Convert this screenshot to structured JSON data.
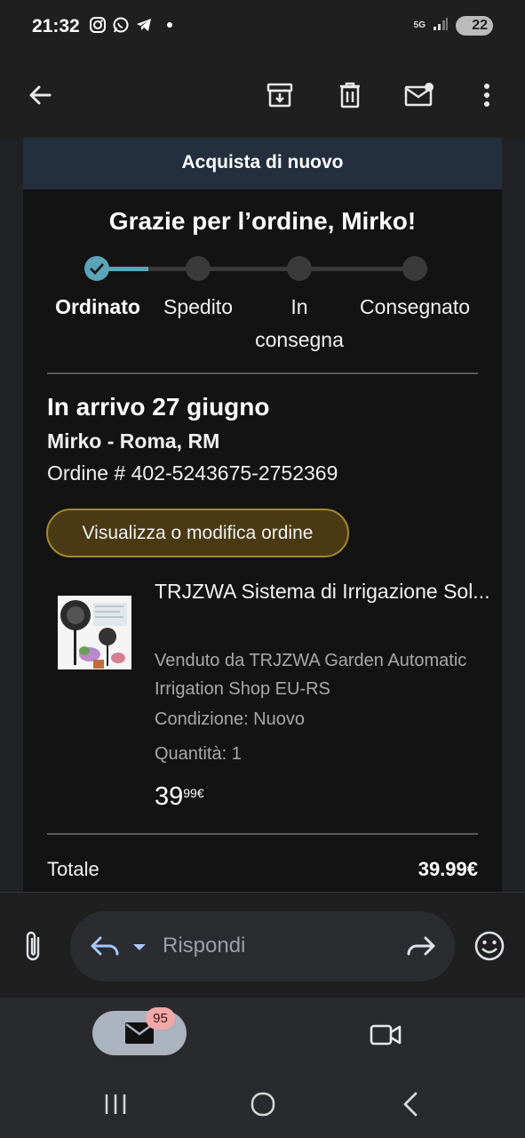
{
  "status_bar": {
    "time": "21:32",
    "network": "5G",
    "battery": "22",
    "icons": [
      "instagram-icon",
      "whatsapp-icon",
      "telegram-icon",
      "notification-dot"
    ]
  },
  "toolbar": {
    "icons": [
      "back-arrow-icon",
      "archive-icon",
      "delete-icon",
      "mark-unread-icon",
      "more-vert-icon"
    ]
  },
  "email": {
    "buy_again": "Acquista di nuovo",
    "thanks": "Grazie per l’ordine, Mirko!",
    "steps": [
      "Ordinato",
      "Spedito",
      "In consegna",
      "Consegnato"
    ],
    "current_step": 0,
    "progress_fraction": 0.2,
    "arrival": "In arrivo 27 giugno",
    "address": "Mirko - Roma, RM",
    "order_number": "Ordine # 402-5243675-2752369",
    "view_order_button": "Visualizza o modifica ordine",
    "product": {
      "title": "TRJZWA Sistema di Irrigazione Sol...",
      "seller": "Venduto da TRJZWA Garden Automatic Irrigation Shop EU-RS",
      "condition": "Condizione: Nuovo",
      "quantity": "Quantità: 1",
      "price_int": "39",
      "price_dec": "99€"
    },
    "total_label": "Totale",
    "total_value": "39.99€"
  },
  "reply": {
    "placeholder": "Rispondi"
  },
  "bottom_tabs": {
    "mail_badge": "95"
  },
  "colors": {
    "brand_header": "#232f3e",
    "progress": "#5aa4b8",
    "button_bg": "#4a3a14",
    "button_border": "#a08835",
    "badge": "#f2a8a8"
  }
}
